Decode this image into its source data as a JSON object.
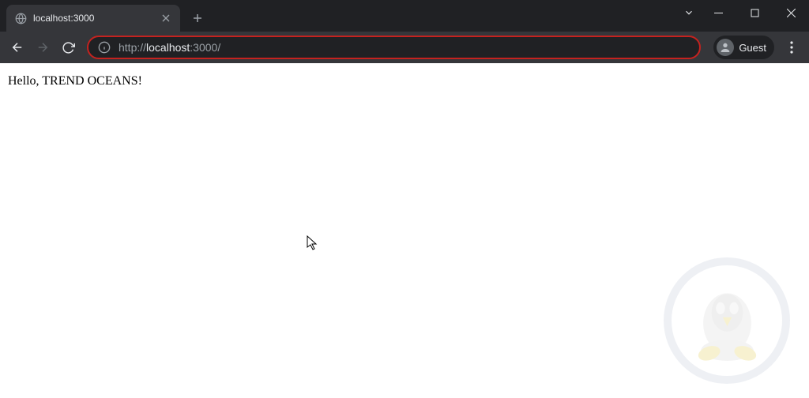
{
  "tab": {
    "title": "localhost:3000"
  },
  "url": {
    "protocol": "http://",
    "host": "localhost",
    "rest": ":3000/"
  },
  "profile": {
    "label": "Guest"
  },
  "page": {
    "body_text": "Hello, TREND OCEANS!"
  }
}
